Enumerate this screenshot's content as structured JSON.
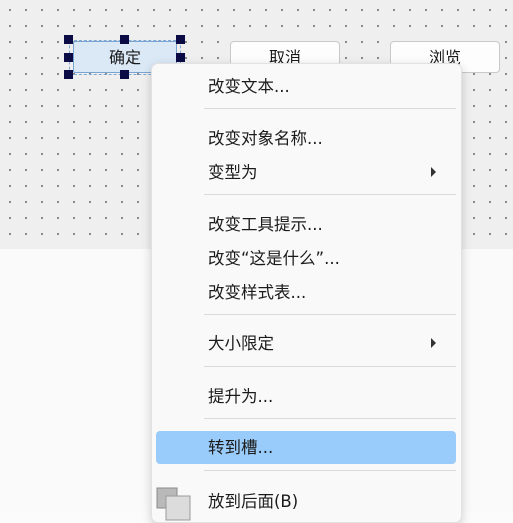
{
  "form": {
    "buttons": [
      {
        "label": "确定"
      },
      {
        "label": "取消"
      },
      {
        "label": "浏览"
      }
    ]
  },
  "context_menu": {
    "items": [
      {
        "label": "改变文本..."
      },
      {
        "label": "改变对象名称..."
      },
      {
        "label": "变型为",
        "submenu": true
      },
      {
        "label": "改变工具提示..."
      },
      {
        "label": "改变“这是什么”..."
      },
      {
        "label": "改变样式表..."
      },
      {
        "label": "大小限定",
        "submenu": true
      },
      {
        "label": "提升为..."
      },
      {
        "label": "转到槽...",
        "highlighted": true
      },
      {
        "label": "放到后面(B)",
        "icon": "send-to-back-icon"
      }
    ]
  }
}
